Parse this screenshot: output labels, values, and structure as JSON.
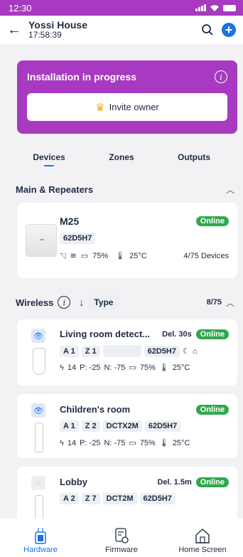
{
  "status_bar": {
    "time": "12:30"
  },
  "header": {
    "title": "Yossi House",
    "subtitle": "17:58:39"
  },
  "install": {
    "title": "Installation in progress",
    "invite_label": "Invite owner"
  },
  "tabs": [
    "Devices",
    "Zones",
    "Outputs"
  ],
  "main_section": {
    "title": "Main & Repeaters",
    "device": {
      "name": "M25",
      "status": "Online",
      "serial": "62D5H7",
      "battery": "75%",
      "temperature": "25°C",
      "devices_count": "4/75 Devices"
    }
  },
  "wireless": {
    "title": "Wireless",
    "sort_label": "Type",
    "count": "8/75",
    "devices": [
      {
        "name": "Living room detect...",
        "delay": "Del. 30s",
        "status": "Online",
        "area": "A 1",
        "zone": "Z 1",
        "model": "",
        "serial": "62D5H7",
        "signal": "14",
        "p": "P: -25",
        "n": "N: -75",
        "battery": "75%",
        "temperature": "25°C"
      },
      {
        "name": "Children's room",
        "delay": "",
        "status": "Online",
        "area": "A 1",
        "zone": "Z 2",
        "model": "DCTX2M",
        "serial": "62D5H7",
        "signal": "14",
        "p": "P: -25",
        "n": "N: -75",
        "battery": "75%",
        "temperature": "25°C"
      },
      {
        "name": "Lobby",
        "delay": "Del. 1.5m",
        "status": "Online",
        "area": "A 2",
        "zone": "Z 7",
        "model": "DCT2M",
        "serial": "62D5H7"
      }
    ]
  },
  "bottom_nav": [
    {
      "label": "Hardware",
      "active": true
    },
    {
      "label": "Firmware",
      "active": false
    },
    {
      "label": "Home Screen",
      "active": false
    }
  ],
  "colors": {
    "accent": "#a73ac0",
    "primary": "#1a73e8",
    "online": "#31a84f"
  }
}
